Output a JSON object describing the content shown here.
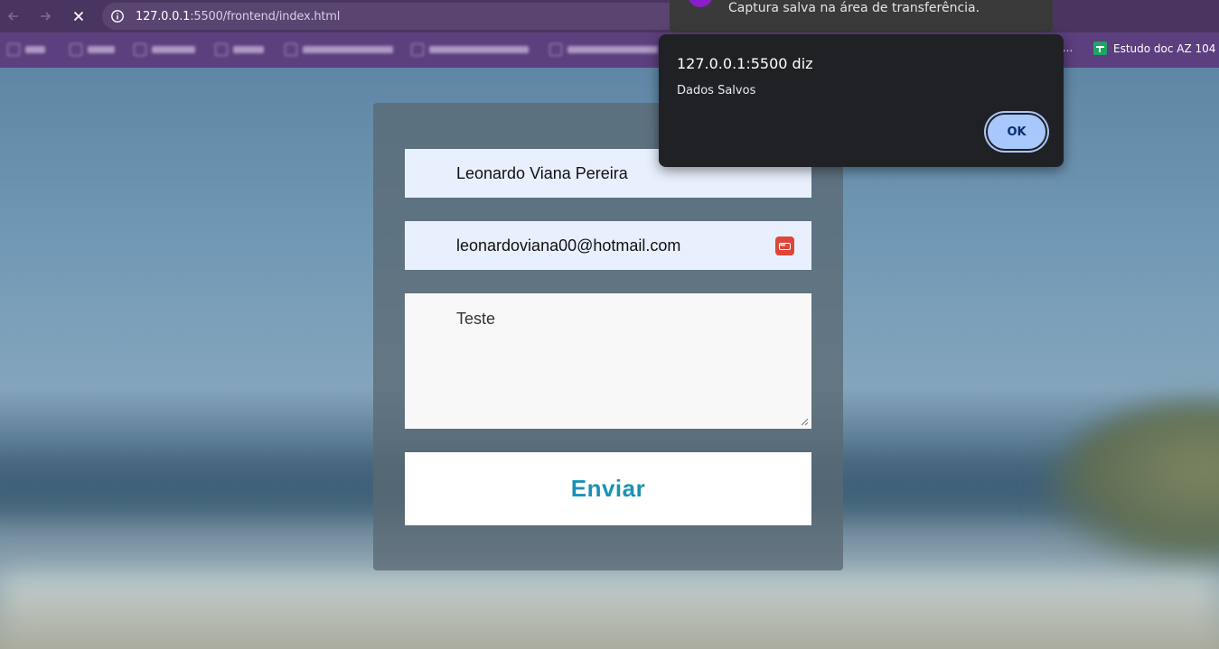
{
  "browser": {
    "url_host": "127.0.0.1",
    "url_rest": ":5500/frontend/index.html",
    "bookmarks_truncated_text": "r...",
    "bookmark_visible": "Estudo doc AZ 104"
  },
  "toast": {
    "message": "Captura salva na área de transferência."
  },
  "dialog": {
    "title": "127.0.0.1:5500 diz",
    "message": "Dados Salvos",
    "ok_label": "OK"
  },
  "form": {
    "name_value": "Leonardo Viana Pereira",
    "email_value": "leonardoviana00@hotmail.com",
    "message_value": "Teste",
    "submit_label": "Enviar"
  },
  "colors": {
    "accent": "#1b91b4",
    "browser_frame": "#4a3560",
    "bookmarks_bar": "#5c3f7e",
    "autofill_bg": "#e8f0fe",
    "dialog_bg": "#202124",
    "dialog_button": "#a8c7fa"
  },
  "icons": [
    "back-arrow-icon",
    "forward-arrow-icon",
    "stop-loading-icon",
    "site-info-icon",
    "password-manager-icon",
    "sheets-bookmark-icon",
    "textarea-resize-icon"
  ]
}
